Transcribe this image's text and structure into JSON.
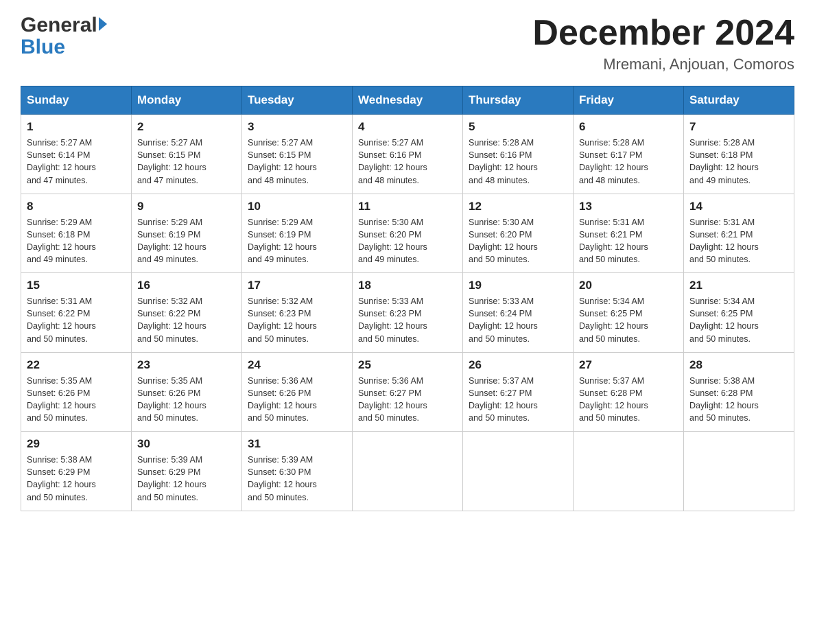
{
  "header": {
    "logo_general": "General",
    "logo_blue": "Blue",
    "month_title": "December 2024",
    "location": "Mremani, Anjouan, Comoros"
  },
  "days_of_week": [
    "Sunday",
    "Monday",
    "Tuesday",
    "Wednesday",
    "Thursday",
    "Friday",
    "Saturday"
  ],
  "weeks": [
    [
      {
        "day": "1",
        "sunrise": "5:27 AM",
        "sunset": "6:14 PM",
        "daylight": "12 hours and 47 minutes."
      },
      {
        "day": "2",
        "sunrise": "5:27 AM",
        "sunset": "6:15 PM",
        "daylight": "12 hours and 47 minutes."
      },
      {
        "day": "3",
        "sunrise": "5:27 AM",
        "sunset": "6:15 PM",
        "daylight": "12 hours and 48 minutes."
      },
      {
        "day": "4",
        "sunrise": "5:27 AM",
        "sunset": "6:16 PM",
        "daylight": "12 hours and 48 minutes."
      },
      {
        "day": "5",
        "sunrise": "5:28 AM",
        "sunset": "6:16 PM",
        "daylight": "12 hours and 48 minutes."
      },
      {
        "day": "6",
        "sunrise": "5:28 AM",
        "sunset": "6:17 PM",
        "daylight": "12 hours and 48 minutes."
      },
      {
        "day": "7",
        "sunrise": "5:28 AM",
        "sunset": "6:18 PM",
        "daylight": "12 hours and 49 minutes."
      }
    ],
    [
      {
        "day": "8",
        "sunrise": "5:29 AM",
        "sunset": "6:18 PM",
        "daylight": "12 hours and 49 minutes."
      },
      {
        "day": "9",
        "sunrise": "5:29 AM",
        "sunset": "6:19 PM",
        "daylight": "12 hours and 49 minutes."
      },
      {
        "day": "10",
        "sunrise": "5:29 AM",
        "sunset": "6:19 PM",
        "daylight": "12 hours and 49 minutes."
      },
      {
        "day": "11",
        "sunrise": "5:30 AM",
        "sunset": "6:20 PM",
        "daylight": "12 hours and 49 minutes."
      },
      {
        "day": "12",
        "sunrise": "5:30 AM",
        "sunset": "6:20 PM",
        "daylight": "12 hours and 50 minutes."
      },
      {
        "day": "13",
        "sunrise": "5:31 AM",
        "sunset": "6:21 PM",
        "daylight": "12 hours and 50 minutes."
      },
      {
        "day": "14",
        "sunrise": "5:31 AM",
        "sunset": "6:21 PM",
        "daylight": "12 hours and 50 minutes."
      }
    ],
    [
      {
        "day": "15",
        "sunrise": "5:31 AM",
        "sunset": "6:22 PM",
        "daylight": "12 hours and 50 minutes."
      },
      {
        "day": "16",
        "sunrise": "5:32 AM",
        "sunset": "6:22 PM",
        "daylight": "12 hours and 50 minutes."
      },
      {
        "day": "17",
        "sunrise": "5:32 AM",
        "sunset": "6:23 PM",
        "daylight": "12 hours and 50 minutes."
      },
      {
        "day": "18",
        "sunrise": "5:33 AM",
        "sunset": "6:23 PM",
        "daylight": "12 hours and 50 minutes."
      },
      {
        "day": "19",
        "sunrise": "5:33 AM",
        "sunset": "6:24 PM",
        "daylight": "12 hours and 50 minutes."
      },
      {
        "day": "20",
        "sunrise": "5:34 AM",
        "sunset": "6:25 PM",
        "daylight": "12 hours and 50 minutes."
      },
      {
        "day": "21",
        "sunrise": "5:34 AM",
        "sunset": "6:25 PM",
        "daylight": "12 hours and 50 minutes."
      }
    ],
    [
      {
        "day": "22",
        "sunrise": "5:35 AM",
        "sunset": "6:26 PM",
        "daylight": "12 hours and 50 minutes."
      },
      {
        "day": "23",
        "sunrise": "5:35 AM",
        "sunset": "6:26 PM",
        "daylight": "12 hours and 50 minutes."
      },
      {
        "day": "24",
        "sunrise": "5:36 AM",
        "sunset": "6:26 PM",
        "daylight": "12 hours and 50 minutes."
      },
      {
        "day": "25",
        "sunrise": "5:36 AM",
        "sunset": "6:27 PM",
        "daylight": "12 hours and 50 minutes."
      },
      {
        "day": "26",
        "sunrise": "5:37 AM",
        "sunset": "6:27 PM",
        "daylight": "12 hours and 50 minutes."
      },
      {
        "day": "27",
        "sunrise": "5:37 AM",
        "sunset": "6:28 PM",
        "daylight": "12 hours and 50 minutes."
      },
      {
        "day": "28",
        "sunrise": "5:38 AM",
        "sunset": "6:28 PM",
        "daylight": "12 hours and 50 minutes."
      }
    ],
    [
      {
        "day": "29",
        "sunrise": "5:38 AM",
        "sunset": "6:29 PM",
        "daylight": "12 hours and 50 minutes."
      },
      {
        "day": "30",
        "sunrise": "5:39 AM",
        "sunset": "6:29 PM",
        "daylight": "12 hours and 50 minutes."
      },
      {
        "day": "31",
        "sunrise": "5:39 AM",
        "sunset": "6:30 PM",
        "daylight": "12 hours and 50 minutes."
      },
      null,
      null,
      null,
      null
    ]
  ],
  "labels": {
    "sunrise": "Sunrise:",
    "sunset": "Sunset:",
    "daylight": "Daylight:"
  }
}
